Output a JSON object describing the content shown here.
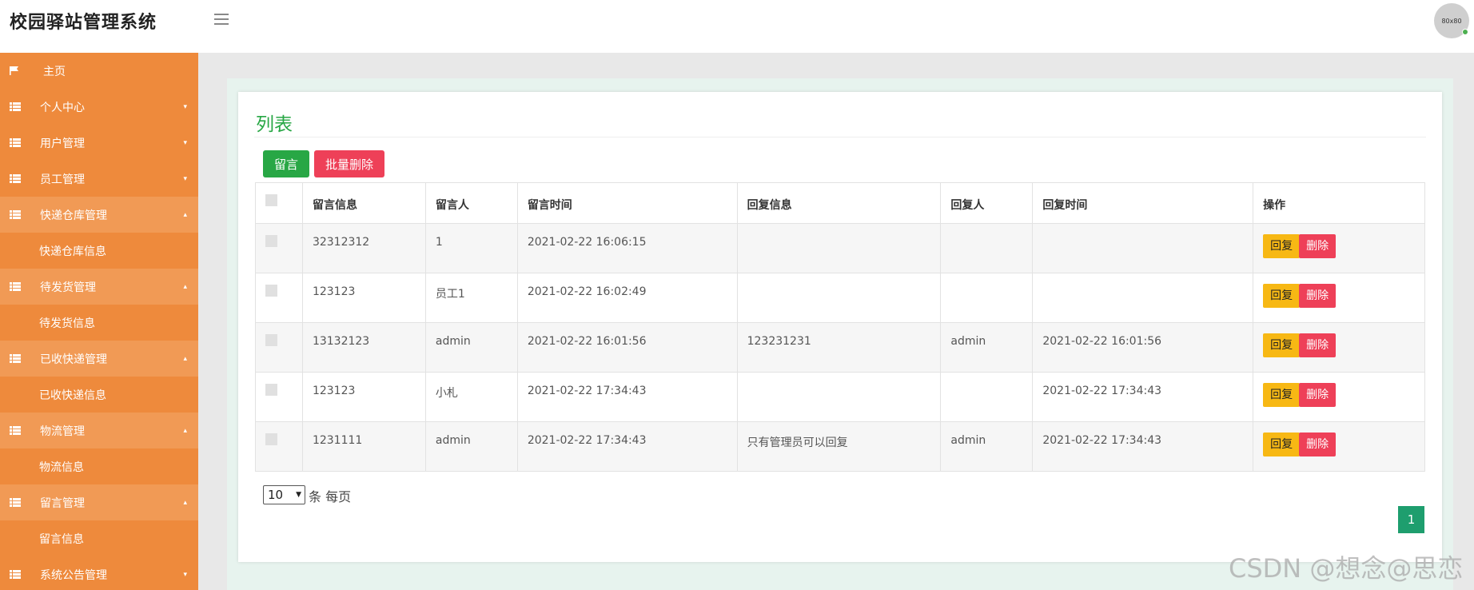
{
  "app": {
    "title": "校园驿站管理系统",
    "avatar_text": "80x80"
  },
  "sidebar": {
    "items": [
      {
        "label": "主页",
        "icon": "flag-icon",
        "caret": ""
      },
      {
        "label": "个人中心",
        "icon": "grid-icon",
        "caret": "▾"
      },
      {
        "label": "用户管理",
        "icon": "grid-icon",
        "caret": "▾"
      },
      {
        "label": "员工管理",
        "icon": "grid-icon",
        "caret": "▾"
      },
      {
        "label": "快递仓库管理",
        "icon": "grid-icon",
        "caret": "▴",
        "sub": "快递仓库信息"
      },
      {
        "label": "待发货管理",
        "icon": "grid-icon",
        "caret": "▴",
        "sub": "待发货信息"
      },
      {
        "label": "已收快递管理",
        "icon": "grid-icon",
        "caret": "▴",
        "sub": "已收快递信息"
      },
      {
        "label": "物流管理",
        "icon": "grid-icon",
        "caret": "▴",
        "sub": "物流信息"
      },
      {
        "label": "留言管理",
        "icon": "grid-icon",
        "caret": "▴",
        "sub": "留言信息"
      },
      {
        "label": "系统公告管理",
        "icon": "grid-icon",
        "caret": "▾"
      }
    ]
  },
  "main": {
    "title": "列表",
    "buttons": {
      "add": "留言",
      "batch_delete": "批量删除"
    },
    "table": {
      "headers": [
        "留言信息",
        "留言人",
        "留言时间",
        "回复信息",
        "回复人",
        "回复时间",
        "操作"
      ],
      "rows": [
        [
          "32312312",
          "1",
          "2021-02-22 16:06:15",
          "",
          "",
          ""
        ],
        [
          "123123",
          "员工1",
          "2021-02-22 16:02:49",
          "",
          "",
          ""
        ],
        [
          "13132123",
          "admin",
          "2021-02-22 16:01:56",
          "123231231",
          "admin",
          "2021-02-22 16:01:56"
        ],
        [
          "123123",
          "小札",
          "2021-02-22 17:34:43",
          "",
          "",
          "2021-02-22 17:34:43"
        ],
        [
          "1231111",
          "admin",
          "2021-02-22 17:34:43",
          "只有管理员可以回复",
          "admin",
          "2021-02-22 17:34:43"
        ]
      ],
      "actions": {
        "reply": "回复",
        "delete": "删除"
      }
    },
    "pagination": {
      "page_size": "10",
      "per_page_label": "条 每页",
      "current_page": "1"
    }
  },
  "watermark": "CSDN @想念@思恋"
}
